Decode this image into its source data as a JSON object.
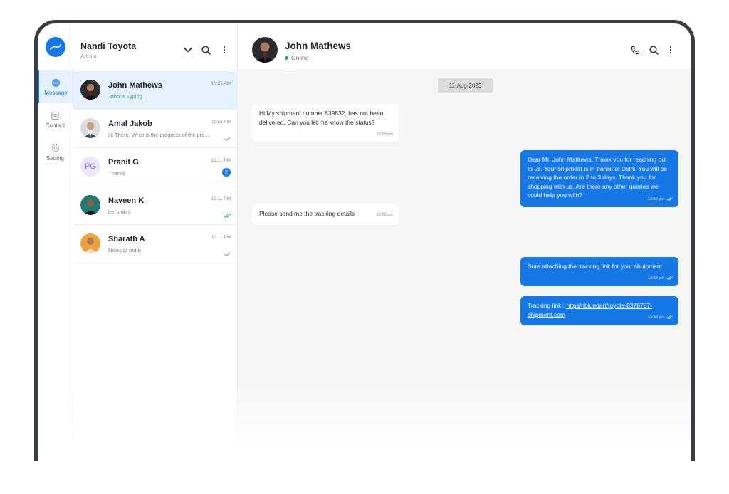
{
  "app": {
    "org_name": "Nandi Toyota",
    "org_role": "Admin",
    "accent": "#1677e6"
  },
  "rail": {
    "items": [
      {
        "label": "Message",
        "icon": "chat-bubble-icon",
        "active": true
      },
      {
        "label": "Contact",
        "icon": "contact-card-icon",
        "active": false
      },
      {
        "label": "Setting",
        "icon": "gear-icon",
        "active": false
      }
    ]
  },
  "conversations": [
    {
      "name": "John Mathews",
      "preview": "John is Typing...",
      "time": "10:23 AM",
      "status": "typing"
    },
    {
      "name": "Amal Jakob",
      "preview": "Hi There, What is the progress of the pro...",
      "time": "11:53 AM",
      "status": "read"
    },
    {
      "name": "Pranit G",
      "initials": "PG",
      "preview": "Thanks",
      "time": "12:11 PM",
      "unread": "2"
    },
    {
      "name": "Naveen K",
      "preview": "Let's do it",
      "time": "12:11 PM",
      "status": "read-green"
    },
    {
      "name": "Sharath A",
      "preview": "Nice job mate",
      "time": "12:11 PM",
      "status": "sent"
    }
  ],
  "chat": {
    "contact_name": "John Mathews",
    "contact_status": "Online",
    "date_chip": "11-Aug-2023",
    "messages": [
      {
        "dir": "in",
        "text": "Hi My shipment number 839832, has not been delivered. Can you let me know the status?",
        "time": "12:59 pm"
      },
      {
        "dir": "out",
        "text": "Dear Mr. John Mathews, Thank you for reaching out to us. Your shipment is in transit at Delhi. You will be receiving the order in 2 to 3 days. Thank you for shopping with us. Are there any other queries we could help you with?",
        "time": "12:59 pm"
      },
      {
        "dir": "in",
        "text": "Please send me the tracking details",
        "time": "12:59 pm"
      },
      {
        "dir": "out",
        "text": "Sure attaching the tracking link for your shuipment",
        "time": "12:59 pm"
      },
      {
        "dir": "out",
        "prefix": "Tracking link : ",
        "link": "https/nbluedart/toyota-8378787-shipment.com",
        "time": "12:59 pm"
      }
    ]
  }
}
